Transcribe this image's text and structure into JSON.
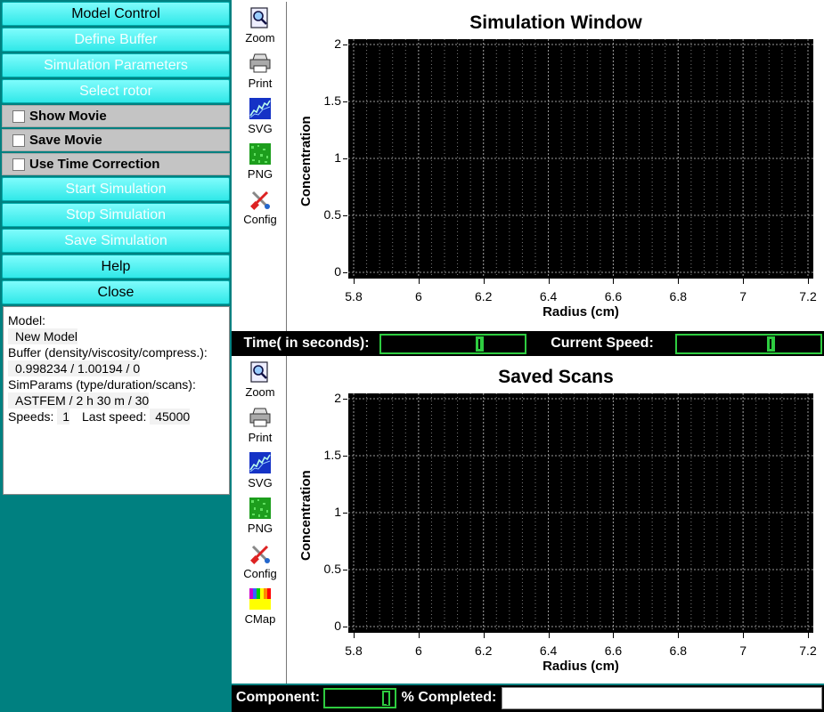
{
  "controls": {
    "buttons": [
      {
        "label": "Model Control",
        "enabled": true
      },
      {
        "label": "Define Buffer",
        "enabled": false
      },
      {
        "label": "Simulation Parameters",
        "enabled": false
      },
      {
        "label": "Select rotor",
        "enabled": false
      }
    ],
    "checkboxes": [
      {
        "label": "Show Movie",
        "checked": false
      },
      {
        "label": "Save Movie",
        "checked": false
      },
      {
        "label": "Use Time Correction",
        "checked": false
      }
    ],
    "buttons2": [
      {
        "label": "Start Simulation",
        "enabled": false
      },
      {
        "label": "Stop Simulation",
        "enabled": false
      },
      {
        "label": "Save Simulation",
        "enabled": false
      },
      {
        "label": "Help",
        "enabled": true
      },
      {
        "label": "Close",
        "enabled": true
      }
    ]
  },
  "info": {
    "model_label": "Model:",
    "model_value": "New Model",
    "buffer_label": "Buffer (density/viscosity/compress.):",
    "buffer_value": "0.998234 / 1.00194 / 0",
    "simparams_label": "SimParams (type/duration/scans):",
    "simparams_value": "ASTFEM / 2 h 30 m / 30",
    "speeds_label": "Speeds:",
    "speeds_value": "1",
    "last_speed_label": "Last speed:",
    "last_speed_value": "45000"
  },
  "tools1": [
    {
      "label": "Zoom",
      "icon": "zoom-icon"
    },
    {
      "label": "Print",
      "icon": "print-icon"
    },
    {
      "label": "SVG",
      "icon": "svg-icon"
    },
    {
      "label": "PNG",
      "icon": "png-icon"
    },
    {
      "label": "Config",
      "icon": "config-icon"
    }
  ],
  "tools2": [
    {
      "label": "Zoom",
      "icon": "zoom-icon"
    },
    {
      "label": "Print",
      "icon": "print-icon"
    },
    {
      "label": "SVG",
      "icon": "svg-icon"
    },
    {
      "label": "PNG",
      "icon": "png-icon"
    },
    {
      "label": "Config",
      "icon": "config-icon"
    },
    {
      "label": "CMap",
      "icon": "cmap-icon"
    }
  ],
  "status": {
    "time_label": "Time( in seconds):",
    "speed_label": "Current Speed:",
    "component_label": "Component:",
    "completed_label": "% Completed:"
  },
  "chart_data": [
    {
      "type": "line",
      "title": "Simulation Window",
      "xlabel": "Radius (cm)",
      "ylabel": "Concentration",
      "xlim": [
        5.8,
        7.2
      ],
      "ylim": [
        0,
        2
      ],
      "xticks": [
        "5.8",
        "6",
        "6.2",
        "6.4",
        "6.6",
        "6.8",
        "7",
        "7.2"
      ],
      "yticks": [
        "0",
        "0.5",
        "1",
        "1.5",
        "2"
      ],
      "grid": true,
      "series": []
    },
    {
      "type": "line",
      "title": "Saved Scans",
      "xlabel": "Radius (cm)",
      "ylabel": "Concentration",
      "xlim": [
        5.8,
        7.2
      ],
      "ylim": [
        0,
        2
      ],
      "xticks": [
        "5.8",
        "6",
        "6.2",
        "6.4",
        "6.6",
        "6.8",
        "7",
        "7.2"
      ],
      "yticks": [
        "0",
        "0.5",
        "1",
        "1.5",
        "2"
      ],
      "grid": true,
      "series": []
    }
  ]
}
